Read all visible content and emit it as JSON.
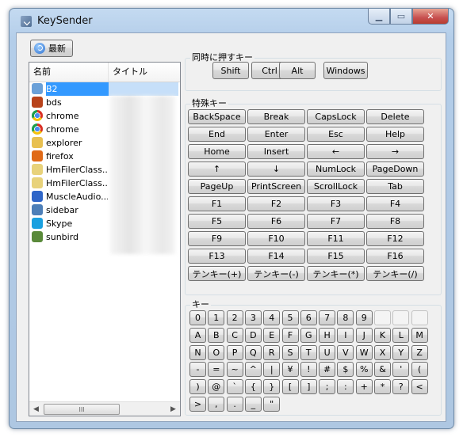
{
  "window": {
    "title": "KeySender"
  },
  "toolbar": {
    "refresh_label": "最新"
  },
  "listview": {
    "columns": [
      "名前",
      "タイトル"
    ],
    "rows": [
      {
        "name": "B2",
        "icon": "b2-icon",
        "color": "#6aa0d8",
        "selected": true
      },
      {
        "name": "bds",
        "icon": "bds-icon",
        "color": "#b8421a"
      },
      {
        "name": "chrome",
        "icon": "chrome-icon",
        "color": "chrome"
      },
      {
        "name": "chrome",
        "icon": "chrome-icon",
        "color": "chrome"
      },
      {
        "name": "explorer",
        "icon": "explorer-icon",
        "color": "#e8c050"
      },
      {
        "name": "firefox",
        "icon": "firefox-icon",
        "color": "#e06a18"
      },
      {
        "name": "HmFilerClass...",
        "icon": "folder-icon",
        "color": "#e8d27a"
      },
      {
        "name": "HmFilerClass...",
        "icon": "folder-icon",
        "color": "#e8d27a"
      },
      {
        "name": "MuscleAudio...",
        "icon": "music-icon",
        "color": "#2f66c8"
      },
      {
        "name": "sidebar",
        "icon": "sidebar-icon",
        "color": "#4d7fb8"
      },
      {
        "name": "Skype",
        "icon": "skype-icon",
        "color": "#1aa0e0"
      },
      {
        "name": "sunbird",
        "icon": "sunbird-icon",
        "color": "#5a8a3a"
      }
    ],
    "scrollbar_grip": "III"
  },
  "modifiers": {
    "label": "同時に押すキー",
    "keys": [
      "Shift",
      "Ctrl",
      "Alt",
      "Windows"
    ]
  },
  "special": {
    "label": "特殊キー",
    "keys": [
      [
        "BackSpace",
        "Break",
        "CapsLock",
        "Delete"
      ],
      [
        "End",
        "Enter",
        "Esc",
        "Help"
      ],
      [
        "Home",
        "Insert",
        "←",
        "→"
      ],
      [
        "↑",
        "↓",
        "NumLock",
        "PageDown"
      ],
      [
        "PageUp",
        "PrintScreen",
        "ScrollLock",
        "Tab"
      ],
      [
        "F1",
        "F2",
        "F3",
        "F4"
      ],
      [
        "F5",
        "F6",
        "F7",
        "F8"
      ],
      [
        "F9",
        "F10",
        "F11",
        "F12"
      ],
      [
        "F13",
        "F14",
        "F15",
        "F16"
      ],
      [
        "テンキー(+)",
        "テンキー(-)",
        "テンキー(*)",
        "テンキー(/)"
      ]
    ]
  },
  "keys": {
    "label": "キー",
    "rows": [
      [
        "0",
        "1",
        "2",
        "3",
        "4",
        "5",
        "6",
        "7",
        "8",
        "9",
        "",
        "",
        ""
      ],
      [
        "A",
        "B",
        "C",
        "D",
        "E",
        "F",
        "G",
        "H",
        "I",
        "J",
        "K",
        "L",
        "M"
      ],
      [
        "N",
        "O",
        "P",
        "Q",
        "R",
        "S",
        "T",
        "U",
        "V",
        "W",
        "X",
        "Y",
        "Z"
      ],
      [
        "-",
        "=",
        "~",
        "^",
        "|",
        "¥",
        "!",
        "#",
        "$",
        "%",
        "&",
        "'",
        "("
      ],
      [
        ")",
        "@",
        "`",
        "{",
        "}",
        "[",
        "]",
        ";",
        ":",
        "+",
        "*",
        "?",
        "<"
      ],
      [
        ">",
        ",",
        ".",
        "_",
        "\""
      ]
    ]
  }
}
